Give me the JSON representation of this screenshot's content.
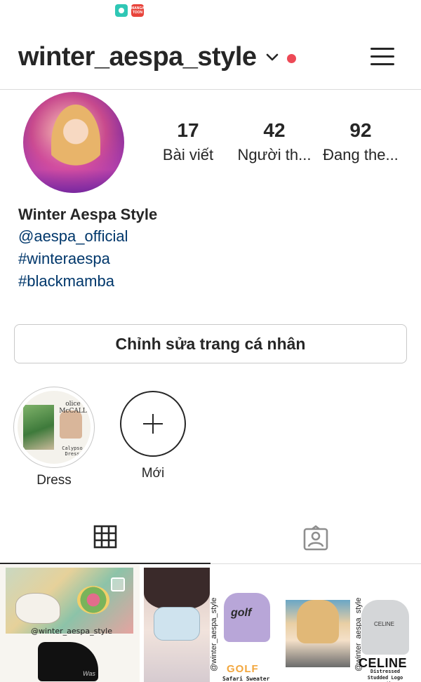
{
  "status_bar": {
    "notification_icons": [
      "chat-bubble-icon",
      "manga-toon-icon"
    ],
    "manga_toon_label": "MANGA TOON"
  },
  "header": {
    "username": "winter_aespa_style",
    "has_notification_dot": true,
    "accent_color": "#ed4956"
  },
  "profile": {
    "stats": {
      "posts": {
        "value": "17",
        "label": "Bài viết"
      },
      "followers": {
        "value": "42",
        "label": "Người th..."
      },
      "following": {
        "value": "92",
        "label": "Đang the..."
      }
    },
    "bio": {
      "name": "Winter Aespa Style",
      "lines": [
        "@aespa_official",
        "#winteraespa",
        "#blackmamba"
      ],
      "link_color": "#00376b"
    },
    "edit_button_label": "Chỉnh sửa trang cá nhân"
  },
  "highlights": [
    {
      "label": "Dress",
      "brand": "olice McCALL",
      "caption": "Calypso Dress"
    },
    {
      "label": "Mới",
      "icon": "plus-icon"
    }
  ],
  "tabs": [
    {
      "name": "posts-grid",
      "icon": "grid-icon",
      "active": true
    },
    {
      "name": "tagged",
      "icon": "tagged-person-icon",
      "active": false
    }
  ],
  "grid_posts": [
    {
      "handle": "@winter_aespa_style",
      "shoe_text": "Was"
    },
    {
      "handle": "@winter_aespa_style",
      "brand": "GOLF",
      "caption": "Safari Sweater",
      "sweater_text": "golf"
    },
    {
      "handle": "@winter_aespa_style",
      "brand": "CELINE",
      "caption": "Distressed Studded Logo Hoodie",
      "hoodie_text": "CELINE"
    }
  ]
}
